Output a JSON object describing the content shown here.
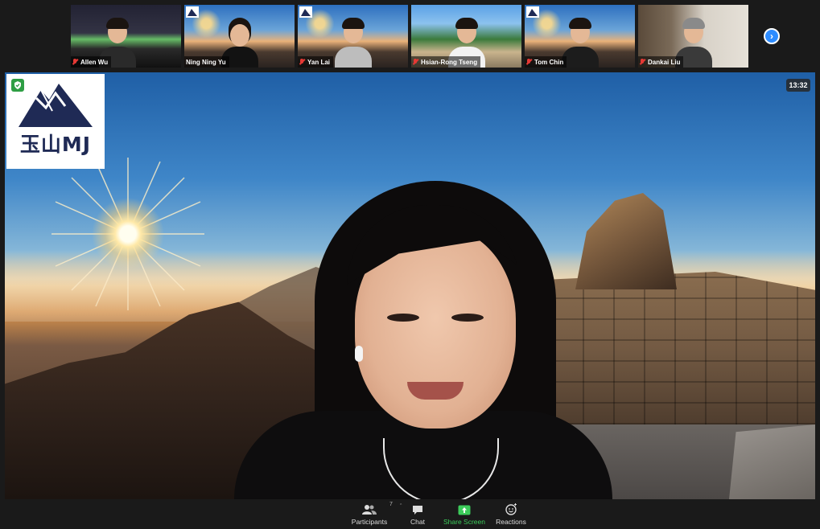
{
  "participants_strip": [
    {
      "name": "Allen Wu",
      "background": "stadium",
      "muted": true,
      "active": false
    },
    {
      "name": "Ning Ning Yu",
      "background": "scenic",
      "muted": false,
      "active": true
    },
    {
      "name": "Yan Lai",
      "background": "scenic",
      "muted": true,
      "active": false
    },
    {
      "name": "Hsian-Rong Tseng",
      "background": "outdoor",
      "muted": true,
      "active": false
    },
    {
      "name": "Tom Chin",
      "background": "scenic",
      "muted": true,
      "active": false
    },
    {
      "name": "Dankai Liu",
      "background": "room",
      "muted": true,
      "active": false
    }
  ],
  "main_video": {
    "logo_text": "玉山MJ",
    "timer": "13:32"
  },
  "toolbar": {
    "participants_label": "Participants",
    "participants_count": "7",
    "chat_label": "Chat",
    "share_label": "Share Screen",
    "reactions_label": "Reactions"
  },
  "colors": {
    "active_speaker_border": "#d7e36a",
    "share_green": "#3ccb5a",
    "next_button": "#2d8cff",
    "security_shield": "#2e9e44",
    "mute_red": "#e53935"
  },
  "icons": [
    "security-shield-icon",
    "mic-muted-icon",
    "chevron-right-icon",
    "participants-icon",
    "chat-icon",
    "share-screen-icon",
    "reactions-icon"
  ]
}
